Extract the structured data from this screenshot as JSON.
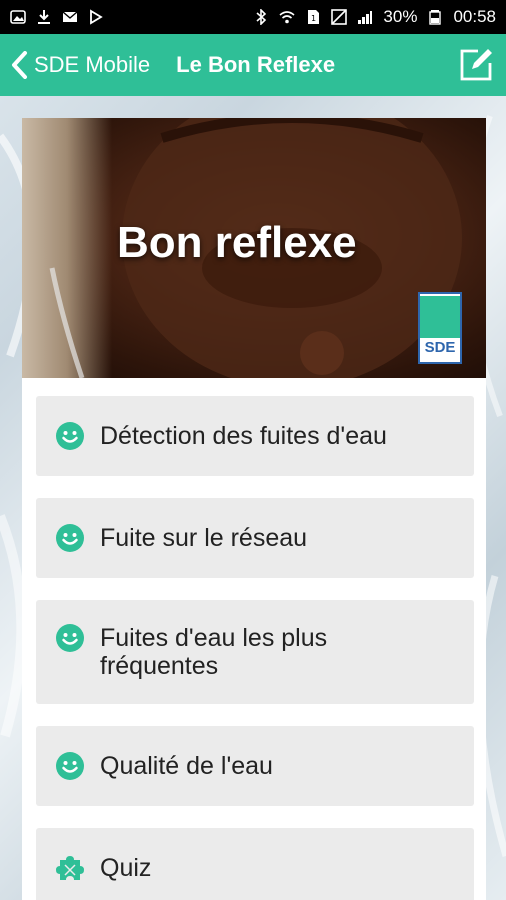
{
  "status_bar": {
    "battery": "30%",
    "time": "00:58"
  },
  "app_bar": {
    "back_label": "SDE Mobile",
    "title": "Le Bon Reflexe"
  },
  "banner": {
    "title": "Bon reflexe",
    "logo_text": "SDE"
  },
  "menu": {
    "items": [
      {
        "label": "Détection des fuites d'eau",
        "icon": "smiley-icon"
      },
      {
        "label": "Fuite sur le réseau",
        "icon": "smiley-icon"
      },
      {
        "label": "Fuites d'eau les plus fréquentes",
        "icon": "smiley-icon"
      },
      {
        "label": "Qualité de l'eau",
        "icon": "smiley-icon"
      },
      {
        "label": "Quiz",
        "icon": "puzzle-icon"
      }
    ]
  },
  "colors": {
    "accent": "#2fbf97",
    "status_bar": "#000000",
    "menu_item_bg": "#ebebeb"
  }
}
